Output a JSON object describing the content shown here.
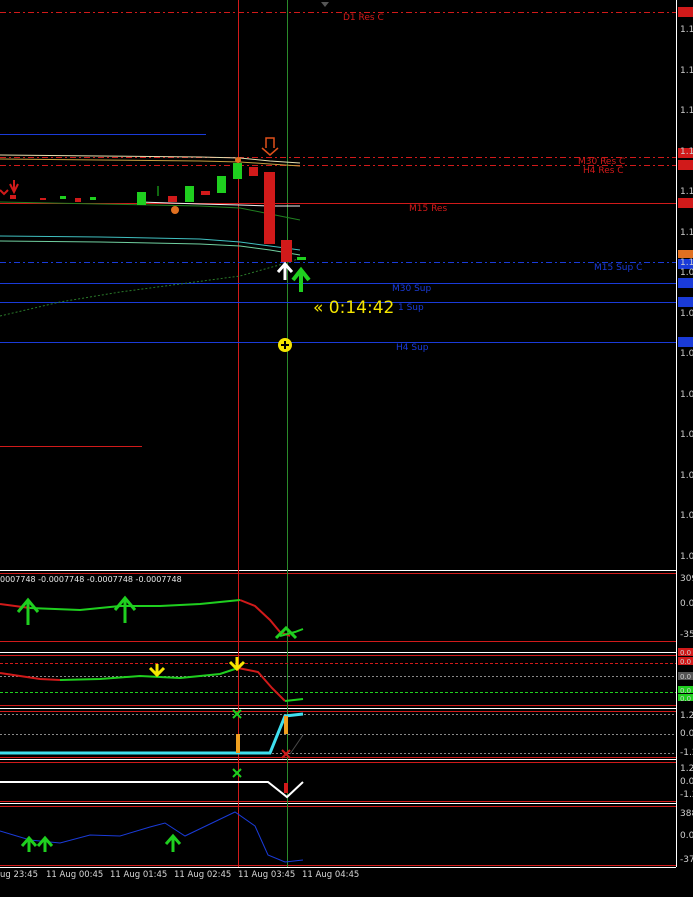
{
  "levels": {
    "d1_res": "D1 Res C",
    "m30_res": "M30 Res C",
    "h4_res": "H4 Res C",
    "m15_res": "M15 Res",
    "m15_sup": "M15 Sup C",
    "m30_sup": "M30 Sup",
    "h1_sup": "1 Sup",
    "h4_sup": "H4 Sup"
  },
  "timer": "« 0:14:42",
  "indicator_values": "0007748 -0.0007748 -0.0007748 -0.0007748",
  "price_axis": {
    "main": [
      "1.1",
      "1.1",
      "1.1",
      "1.1",
      "1.1",
      "1.1",
      "1.1",
      "1.0",
      "1.0",
      "1.0",
      "1.0",
      "1.0",
      "1.0",
      "1.0",
      "1.0"
    ],
    "p1": [
      "309",
      "0.00",
      "-35"
    ],
    "p2": [
      "0.0",
      "0.0",
      "0.0",
      "0.0",
      "0.0"
    ],
    "p3": [
      "1.2",
      "0.0",
      "-1.2"
    ],
    "p4": [
      "1.2",
      "0.0",
      "-1.2"
    ],
    "p5": [
      "388",
      "0.00",
      "-37"
    ]
  },
  "time_axis": [
    "ug 23:45",
    "11 Aug 00:45",
    "11 Aug 01:45",
    "11 Aug 02:45",
    "11 Aug 03:45",
    "11 Aug 04:45"
  ],
  "colors": {
    "bull": "#1fcf1f",
    "bear": "#d11a1a",
    "res": "#d11a1a",
    "sup": "#1a3bd9",
    "timer": "#f5e600",
    "cyan": "#3fe0f0"
  }
}
